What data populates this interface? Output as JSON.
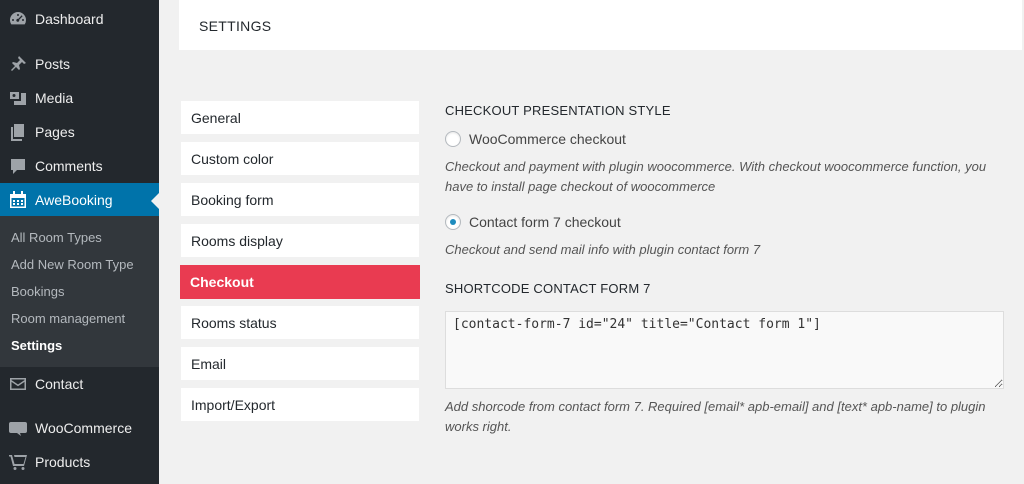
{
  "sidebar": {
    "items": [
      {
        "label": "Dashboard",
        "icon": "dashboard-icon"
      },
      {
        "label": "Posts",
        "icon": "pushpin-icon"
      },
      {
        "label": "Media",
        "icon": "media-icon"
      },
      {
        "label": "Pages",
        "icon": "pages-icon"
      },
      {
        "label": "Comments",
        "icon": "comment-icon"
      },
      {
        "label": "AweBooking",
        "icon": "calendar-icon"
      },
      {
        "label": "Contact",
        "icon": "mail-icon"
      },
      {
        "label": "WooCommerce",
        "icon": "woocommerce-icon"
      },
      {
        "label": "Products",
        "icon": "cart-icon"
      }
    ],
    "submenu": [
      {
        "label": "All Room Types"
      },
      {
        "label": "Add New Room Type"
      },
      {
        "label": "Bookings"
      },
      {
        "label": "Room management"
      },
      {
        "label": "Settings"
      }
    ],
    "active_color": "#0073aa"
  },
  "header": {
    "title": "SETTINGS"
  },
  "tabs": [
    {
      "label": "General"
    },
    {
      "label": "Custom color"
    },
    {
      "label": "Booking form"
    },
    {
      "label": "Rooms display"
    },
    {
      "label": "Checkout"
    },
    {
      "label": "Rooms status"
    },
    {
      "label": "Email"
    },
    {
      "label": "Import/Export"
    }
  ],
  "active_tab_color": "#e93b51",
  "checkout": {
    "title": "CHECKOUT PRESENTATION STYLE",
    "options": [
      {
        "label": "WooCommerce checkout",
        "selected": false,
        "desc": "Checkout and payment with plugin woocommerce. With checkout woocommerce function, you have to install page checkout of woocommerce"
      },
      {
        "label": "Contact form 7 checkout",
        "selected": true,
        "desc": "Checkout and send mail info with plugin contact form 7"
      }
    ]
  },
  "shortcode": {
    "title": "SHORTCODE CONTACT FORM 7",
    "value": "[contact-form-7 id=\"24\" title=\"Contact form 1\"]",
    "desc": "Add shorcode from contact form 7. Required [email* apb-email] and [text* apb-name] to plugin works right."
  }
}
